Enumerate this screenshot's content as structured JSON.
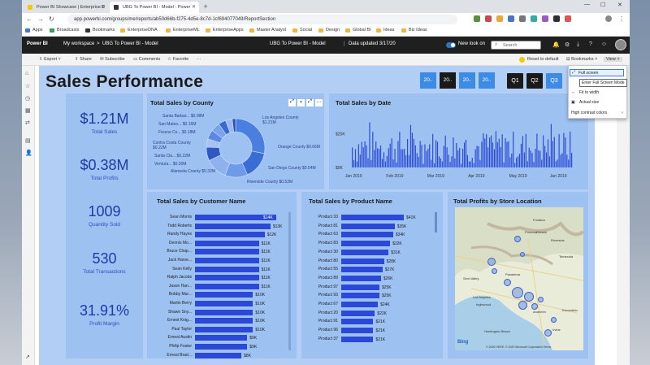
{
  "browser": {
    "tabs": [
      {
        "title": "Power BI Showcase | Enterprise D",
        "active": false
      },
      {
        "title": "UBG To Power BI - Model - Power",
        "active": true
      }
    ],
    "new_tab": "+",
    "window_controls": [
      "—",
      "☐",
      "✕"
    ],
    "url": "app.powerbi.com/groups/me/reports/ab50d66b-f275-4d5e-8c7d-1cf694077049/ReportSection",
    "bookmarks": [
      "Apps",
      "Broadcasts",
      "Bookmarks",
      "EnterpriseDNA",
      "EnterpriseML",
      "EnterpriseApps",
      "Master Analyst",
      "Social",
      "Design",
      "Global BI",
      "Ideas",
      "Biz Ideas"
    ]
  },
  "pbi": {
    "brand": "Power BI",
    "breadcrumb": [
      "My workspace",
      ">",
      "UBG To Power BI - Model"
    ],
    "report_title": "UBG To Power BI - Model",
    "data_updated": "Data updated 3/17/20",
    "new_look": "New look on",
    "search_placeholder": "Search",
    "actions": [
      "Export",
      "Share",
      "Subscribe",
      "Comments",
      "Favorite",
      "···"
    ],
    "reset": "Reset to default",
    "bookmarks_btn": "Bookmarks",
    "view_btn": "View"
  },
  "report": {
    "title": "Sales Performance",
    "year_buttons": [
      "20..",
      "20..",
      "20..",
      "20.."
    ],
    "quarter_buttons": [
      "Q1",
      "Q2",
      "Q3"
    ],
    "kpis": [
      {
        "value": "$1.21M",
        "label": "Total Sales"
      },
      {
        "value": "$0.38M",
        "label": "Total Profits"
      },
      {
        "value": "1009",
        "label": "Quantity Sold"
      },
      {
        "value": "530",
        "label": "Total Transactions"
      },
      {
        "value": "31.91%",
        "label": "Profit Margin"
      }
    ],
    "county_title": "Total Sales by County",
    "date_title": "Total Sales by Date",
    "customer_title": "Total Sales by Customer Name",
    "product_title": "Total Sales by Product Name",
    "map_title": "Total Profits by Store Location",
    "map_labels": [
      "Fontana",
      "Riverside",
      "Pomona",
      "Ontario",
      "Simi Valley",
      "Pasadena",
      "Los Angeles",
      "Inglewood",
      "Anaheim",
      "Irvine",
      "Huntington Beach",
      "Temecula",
      "Escondido"
    ],
    "map_copyright": "© 2020 HERE, © 2020 Microsoft Corporation Terms",
    "bing": "Bing"
  },
  "chart_data": [
    {
      "type": "pie",
      "title": "Total Sales by County",
      "labels": [
        "Los Angeles County",
        "Orange County",
        "San Diego County",
        "Riverside County",
        "Alameda County",
        "Ventura County",
        "Santa Clara County",
        "Contra Costa County",
        "Fresno County",
        "San Mateo County",
        "Santa Barbara County"
      ],
      "display_labels": [
        "Los Angeles County $1.21M",
        "Orange County $0.66M",
        "San Diego County $0.54M",
        "Riverside County $0.52M",
        "Alameda County $0.32M",
        "Ventura... $0.20M",
        "Santa Cla... $0.22M",
        "Contra Costa County $0.22M",
        "Fresno Co... $0.18M",
        "San Mateo... $0.16M",
        "Santa Barbar... $0.08M"
      ],
      "values": [
        1.21,
        0.66,
        0.54,
        0.52,
        0.32,
        0.2,
        0.22,
        0.22,
        0.18,
        0.16,
        0.08
      ],
      "colors": [
        "#4a7fe0",
        "#3a6dd3",
        "#6e9ae8",
        "#8fb2ee",
        "#2f59c2",
        "#a9c3f1",
        "#5a88e4",
        "#7aa3ec",
        "#3c68cf",
        "#99b9ef",
        "#2a4eb4"
      ]
    },
    {
      "type": "bar",
      "title": "Total Sales by Date",
      "x_tick_labels": [
        "Jan 2019",
        "Feb 2019",
        "Mar 2019",
        "Apr 2019",
        "May 2019",
        "Jun 2019"
      ],
      "y_tick_labels": [
        "$0K",
        "$20K"
      ],
      "ylim": [
        0,
        26
      ]
    },
    {
      "type": "bar",
      "title": "Total Sales by Customer Name",
      "categories": [
        "Sean Morris",
        "Todd Roberts",
        "Randy Hayes",
        "Dennis Mo...",
        "Bruce Chap...",
        "Jack Harve...",
        "Sean Kelly",
        "Ralph Jacobs",
        "Jason Han...",
        "Bobby Mur...",
        "Martin Berry",
        "Shawn Sny...",
        "Ernest Knig...",
        "Paul Taylor",
        "Ernest Austin",
        "Philip Foster",
        "Ernest Brad..."
      ],
      "values": [
        14,
        13,
        12,
        11,
        11,
        11,
        11,
        11,
        11,
        10,
        10,
        10,
        10,
        10,
        9,
        9,
        8
      ],
      "value_labels": [
        "$14K",
        "$13K",
        "$12K",
        "$11K",
        "$11K",
        "$11K",
        "$11K",
        "$11K",
        "$11K",
        "$10K",
        "$10K",
        "$10K",
        "$10K",
        "$10K",
        "$9K",
        "$9K",
        "$8K"
      ]
    },
    {
      "type": "bar",
      "title": "Total Sales by Product Name",
      "categories": [
        "Product 33",
        "Product 81",
        "Product 63",
        "Product 83",
        "Product 30",
        "Product 80",
        "Product 55",
        "Product 89",
        "Product 97",
        "Product 93",
        "Product 67",
        "Product 20",
        "Product 91",
        "Product 96",
        "Product 37"
      ],
      "values": [
        41,
        35,
        34,
        32,
        31,
        28,
        27,
        26,
        25,
        25,
        24,
        22,
        21,
        21,
        21
      ],
      "value_labels": [
        "$41K",
        "$35K",
        "$34K",
        "$32K",
        "$31K",
        "$28K",
        "$27K",
        "$26K",
        "$25K",
        "$25K",
        "$24K",
        "$22K",
        "$21K",
        "$21K",
        "$21K"
      ]
    }
  ],
  "bookmarks_menu": {
    "items": [
      "Full screen",
      "Fit to width",
      "Actual size",
      "High contrast colors"
    ],
    "tooltip": "Enter Full Screen Mode"
  },
  "colors": {
    "canvas": "#b3cef5",
    "panel": "#9dc1f1",
    "bar": "#2b49d6",
    "accent": "#3c8ce6",
    "kpi": "#1e3aa8"
  }
}
